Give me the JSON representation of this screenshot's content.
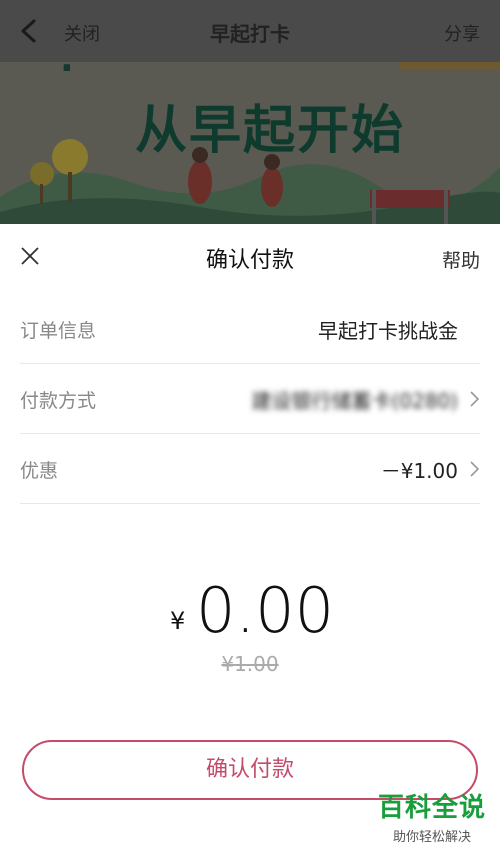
{
  "topbar": {
    "close": "关闭",
    "title": "早起打卡",
    "share": "分享"
  },
  "banner": {
    "slogan": "从早起开始"
  },
  "sheet": {
    "title": "确认付款",
    "help": "帮助",
    "rows": [
      {
        "label": "订单信息",
        "value": "早起打卡挑战金"
      },
      {
        "label": "付款方式",
        "value": "建设银行储蓄卡(0280)"
      },
      {
        "label": "优惠",
        "value": "－¥1.00"
      }
    ],
    "currency": "¥",
    "amount": "0.00",
    "original": "¥1.00",
    "confirm": "确认付款"
  },
  "watermark": {
    "main": "百科全说",
    "sub": "助你轻松解决"
  }
}
